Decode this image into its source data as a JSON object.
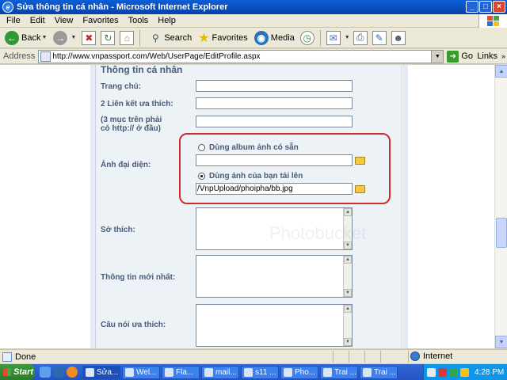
{
  "window": {
    "title": "Sửa thông tin cá nhân - Microsoft Internet Explorer",
    "controls": {
      "minimize": "_",
      "maximize": "□",
      "close": "×"
    }
  },
  "menubar": [
    "File",
    "Edit",
    "View",
    "Favorites",
    "Tools",
    "Help"
  ],
  "toolbar": {
    "back_label": "Back",
    "search_label": "Search",
    "favorites_label": "Favorites",
    "media_label": "Media"
  },
  "address": {
    "label": "Address",
    "url": "http://www.vnpassport.com/Web/UserPage/EditProfile.aspx",
    "go_label": "Go",
    "links_label": "Links"
  },
  "form": {
    "section_title": "Thông tin cá nhân",
    "homepage_label": "Trang chủ:",
    "links_label": "2 Liên kết ưa thích:",
    "links_note_1": "(3 mục trên phải",
    "links_note_2": "có http:// ở đầu)",
    "avatar_label": "Ảnh đại diện:",
    "avatar_option_album": "Dùng album ảnh có sẵn",
    "avatar_option_upload": "Dùng ảnh của bạn tải lên",
    "avatar_upload_value": "/VnpUpload/phoipha/bb.jpg",
    "avatar_selected": "upload",
    "hobbies_label": "Sở thích:",
    "latest_info_label": "Thông tin mới nhất:",
    "favorite_quote_label": "Câu nói ưa thích:"
  },
  "watermark": {
    "text": "Photobucket"
  },
  "status": {
    "text": "Done",
    "zone": "Internet"
  },
  "taskbar": {
    "start_label": "Start",
    "tasks": [
      "Sửa...",
      "Wel...",
      "Fla...",
      "mail...",
      "s11 ...",
      "Pho...",
      "Trai ...",
      "Trai ..."
    ],
    "clock": "4:28 PM"
  },
  "colors": {
    "highlight_ring": "#d12a2a",
    "label_text": "#4a5a78",
    "title_bar": "#0a5fd8"
  }
}
